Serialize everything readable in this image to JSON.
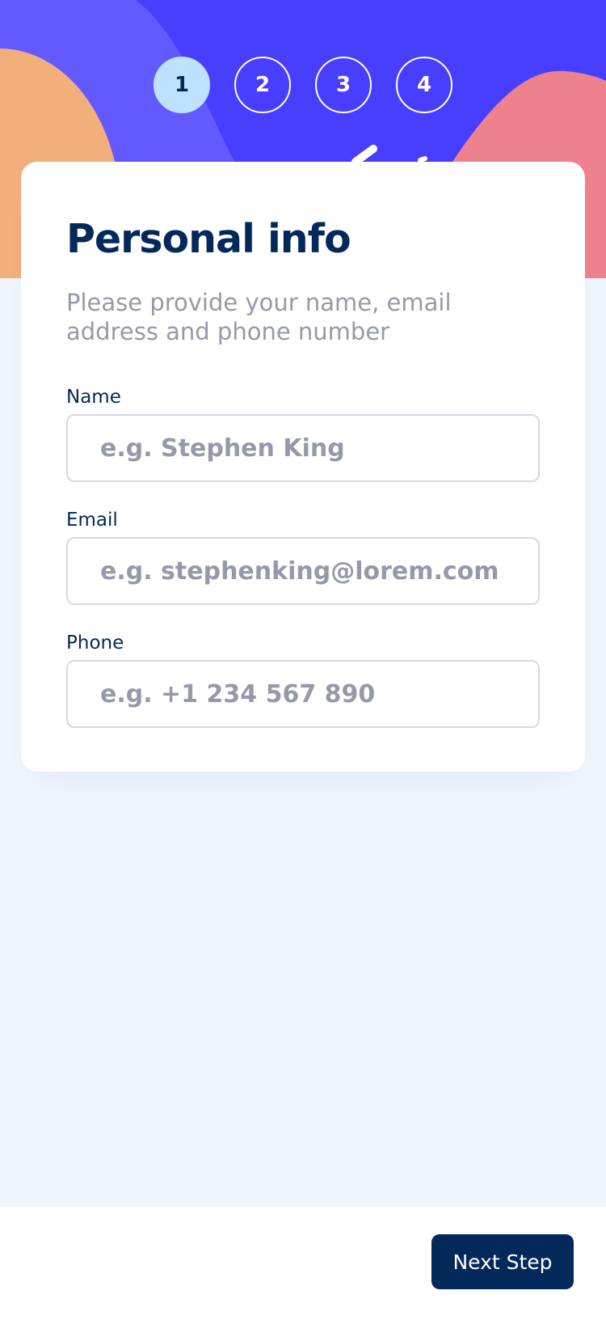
{
  "steps": [
    {
      "number": "1",
      "active": true
    },
    {
      "number": "2",
      "active": false
    },
    {
      "number": "3",
      "active": false
    },
    {
      "number": "4",
      "active": false
    }
  ],
  "form": {
    "title": "Personal info",
    "subtitle": "Please provide your name, email address and phone number",
    "fields": {
      "name": {
        "label": "Name",
        "placeholder": "e.g. Stephen King",
        "value": ""
      },
      "email": {
        "label": "Email",
        "placeholder": "e.g. stephenking@lorem.com",
        "value": ""
      },
      "phone": {
        "label": "Phone",
        "placeholder": "e.g. +1 234 567 890",
        "value": ""
      }
    }
  },
  "footer": {
    "next_label": "Next Step"
  },
  "colors": {
    "header_blue": "#483eff",
    "header_violet": "#6259ff",
    "blob_orange": "#ffaf7e",
    "blob_pink": "#f9818e",
    "active_step": "#bee2fd",
    "marine_blue": "#022959",
    "grey_text": "#9699aa",
    "border": "#d6d9e6",
    "page_bg": "#eef5ff"
  }
}
